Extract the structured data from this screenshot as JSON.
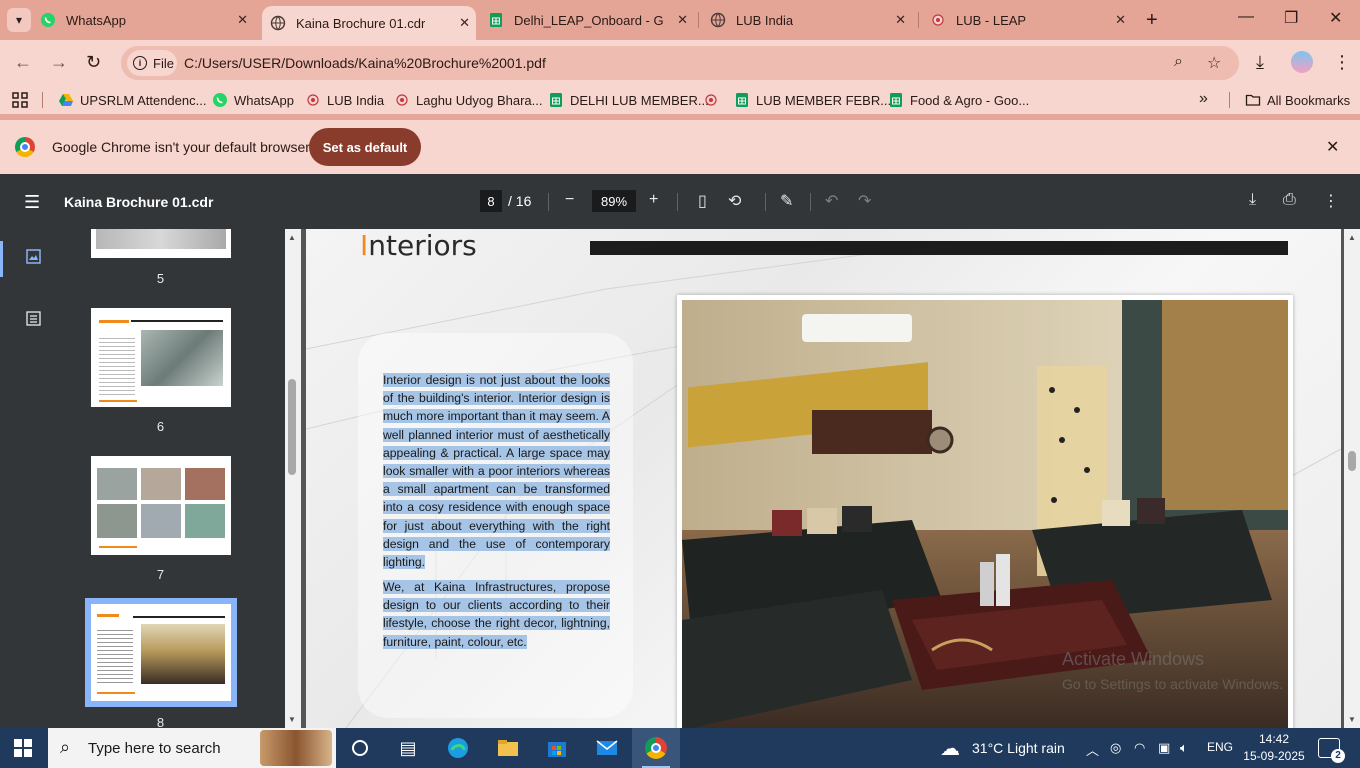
{
  "browser": {
    "tabs": [
      {
        "label": "WhatsApp",
        "icon": "whatsapp-icon",
        "active": false
      },
      {
        "label": "Kaina Brochure 01.cdr",
        "icon": "globe-icon",
        "active": true
      },
      {
        "label": "Delhi_LEAP_Onboard - Goog",
        "icon": "sheets-icon",
        "active": false
      },
      {
        "label": "LUB India",
        "icon": "globe-icon",
        "active": false
      },
      {
        "label": "LUB - LEAP",
        "icon": "lub-icon",
        "active": false
      }
    ],
    "url_chip": "File",
    "url": "C:/Users/USER/Downloads/Kaina%20Brochure%2001.pdf"
  },
  "bookmarks": {
    "items": [
      {
        "label": "UPSRLM Attendenc...",
        "icon": "drive-icon"
      },
      {
        "label": "WhatsApp",
        "icon": "whatsapp-icon"
      },
      {
        "label": "LUB India",
        "icon": "lub-icon"
      },
      {
        "label": "Laghu Udyog Bhara...",
        "icon": "lub-icon"
      },
      {
        "label": "DELHI LUB MEMBER...",
        "icon": "sheets-icon"
      },
      {
        "label": "",
        "icon": "lub-icon"
      },
      {
        "label": "LUB MEMBER FEBR...",
        "icon": "sheets-icon"
      },
      {
        "label": "Food & Agro - Goo...",
        "icon": "sheets-icon"
      }
    ],
    "all_label": "All Bookmarks"
  },
  "infobar": {
    "message": "Google Chrome isn't your default browser",
    "button": "Set as default"
  },
  "pdf": {
    "title": "Kaina Brochure 01.cdr",
    "current_page": "8",
    "total_pages": "/ 16",
    "zoom": "89%",
    "thumbnails": [
      {
        "num": "5"
      },
      {
        "num": "6"
      },
      {
        "num": "7"
      },
      {
        "num": "8"
      }
    ],
    "page": {
      "heading_first": "I",
      "heading_rest": "nteriors",
      "para1": "Interior design is not just about the looks of the building's interior. Interior design is much more important than it may seem. A well planned interior must of aesthetically appealing & practical. A large space may look smaller with a poor interiors whereas a small apartment can be transformed into a cosy residence with enough space for just about everything with the right design and the use of contemporary lighting.",
      "para2": "We, at Kaina Infrastructures, propose design to our clients according to their lifestyle, choose the right decor, lightning, furniture, paint, colour, etc."
    }
  },
  "watermark": {
    "line1": "Activate Windows",
    "line2": "Go to Settings to activate Windows."
  },
  "taskbar": {
    "search_placeholder": "Type here to search",
    "weather": "31°C  Light rain",
    "language": "ENG",
    "time": "14:42",
    "date": "15-09-2025",
    "notifications": "2"
  },
  "colors": {
    "tabstrip": "#e4a597",
    "toolbar": "#f6d6ce",
    "accent_button": "#8a3c2c",
    "pdf_bar": "#323639",
    "heading_accent": "#f08a1d",
    "selection": "#a6c4e6"
  }
}
